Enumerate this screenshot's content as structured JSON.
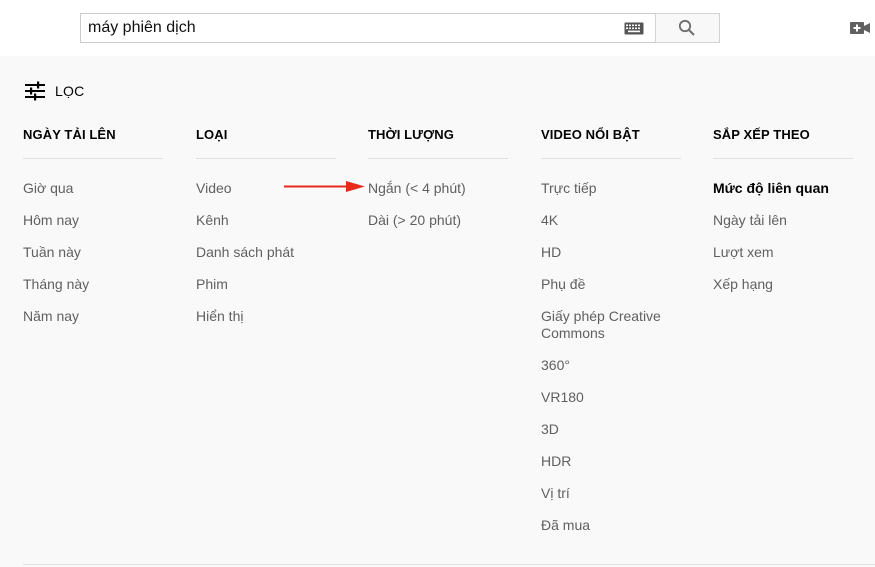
{
  "search": {
    "query": "máy phiên dịch"
  },
  "filter": {
    "label": "LỌC"
  },
  "columns": [
    {
      "title": "NGÀY TẢI LÊN",
      "items": [
        "Giờ qua",
        "Hôm nay",
        "Tuần này",
        "Tháng này",
        "Năm nay"
      ]
    },
    {
      "title": "LOẠI",
      "items": [
        "Video",
        "Kênh",
        "Danh sách phát",
        "Phim",
        "Hiển thị"
      ]
    },
    {
      "title": "THỜI LƯỢNG",
      "items": [
        "Ngắn (< 4 phút)",
        "Dài (> 20 phút)"
      ]
    },
    {
      "title": "VIDEO NỔI BẬT",
      "items": [
        "Trực tiếp",
        "4K",
        "HD",
        "Phụ đề",
        "Giấy phép Creative Commons",
        "360°",
        "VR180",
        "3D",
        "HDR",
        "Vị trí",
        "Đã mua"
      ]
    },
    {
      "title": "SẮP XẾP THEO",
      "items": [
        "Mức độ liên quan",
        "Ngày tải lên",
        "Lượt xem",
        "Xếp hạng"
      ],
      "selected": "Mức độ liên quan"
    }
  ],
  "colors": {
    "annotation_arrow": "#e8291c"
  }
}
